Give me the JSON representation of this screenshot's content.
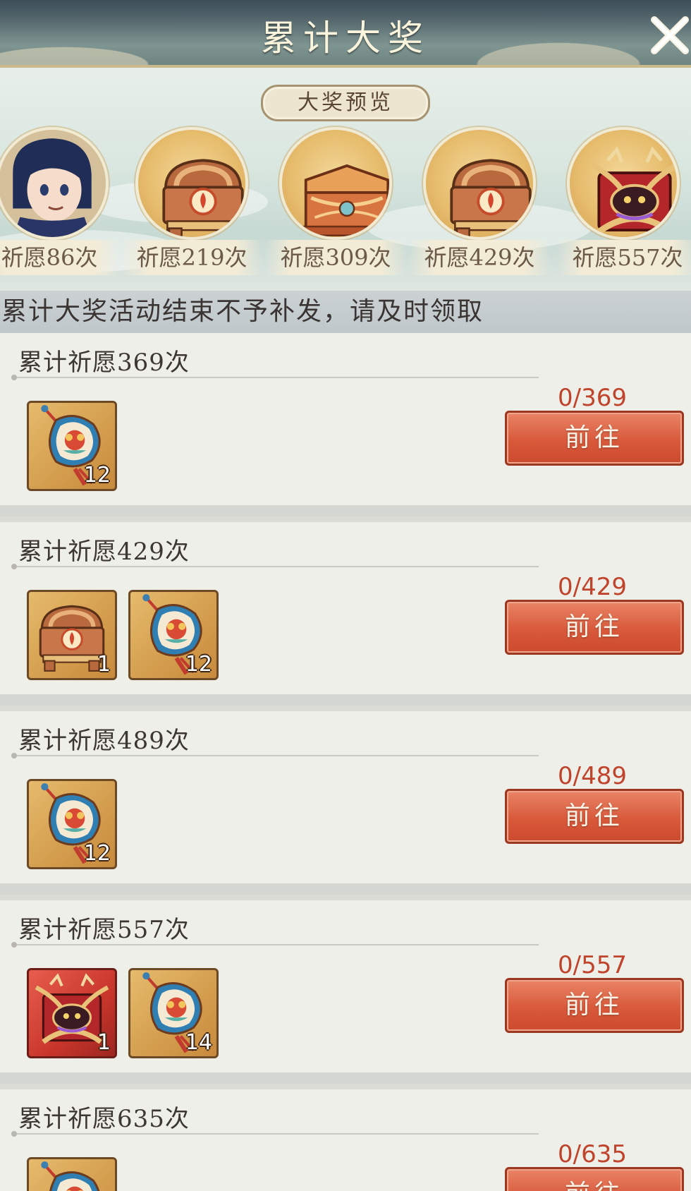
{
  "header": {
    "title": "累计大奖"
  },
  "preview": {
    "tag": "大奖预览",
    "prizes": [
      {
        "label": "祈愿86次",
        "icon": "character-portrait"
      },
      {
        "label": "祈愿219次",
        "icon": "treasure-chest"
      },
      {
        "label": "祈愿309次",
        "icon": "ornate-chest"
      },
      {
        "label": "祈愿429次",
        "icon": "treasure-chest"
      },
      {
        "label": "祈愿557次",
        "icon": "dragon-chest"
      }
    ]
  },
  "notice": "累计大奖活动结束不予补发，请及时领取",
  "tasks": [
    {
      "title": "累计祈愿369次",
      "progress": "0/369",
      "button": "前往",
      "items": [
        {
          "icon": "charm-pendant",
          "count": "12"
        }
      ]
    },
    {
      "title": "累计祈愿429次",
      "progress": "0/429",
      "button": "前往",
      "items": [
        {
          "icon": "treasure-chest",
          "count": "1"
        },
        {
          "icon": "charm-pendant",
          "count": "12"
        }
      ]
    },
    {
      "title": "累计祈愿489次",
      "progress": "0/489",
      "button": "前往",
      "items": [
        {
          "icon": "charm-pendant",
          "count": "12"
        }
      ]
    },
    {
      "title": "累计祈愿557次",
      "progress": "0/557",
      "button": "前往",
      "items": [
        {
          "icon": "dragon-chest",
          "count": "1"
        },
        {
          "icon": "charm-pendant",
          "count": "14"
        }
      ]
    },
    {
      "title": "累计祈愿635次",
      "progress": "0/635",
      "button": "前往",
      "items": [
        {
          "icon": "charm-pendant",
          "count": ""
        }
      ]
    }
  ],
  "colors": {
    "accent": "#d9593b",
    "progress": "#c0432b",
    "title": "#fbf4dd"
  }
}
